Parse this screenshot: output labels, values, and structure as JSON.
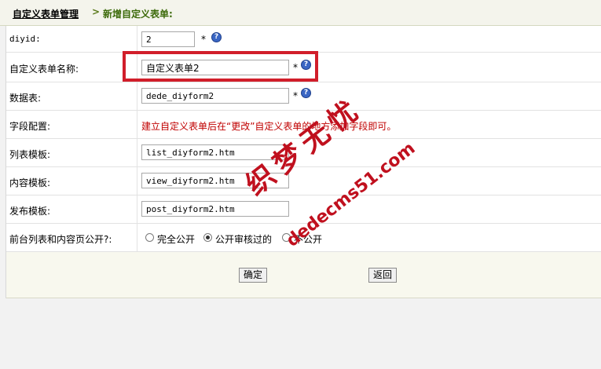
{
  "breadcrumb": {
    "parent": "自定义表单管理",
    "separator": ">",
    "current": "新增自定义表单:"
  },
  "form": {
    "diyid_label": "diyid:",
    "diyid_value": "2",
    "name_label": "自定义表单名称:",
    "name_value": "自定义表单2",
    "table_label": "数据表:",
    "table_value": "dede_diyform2",
    "field_label": "字段配置:",
    "field_hint": "建立自定义表单后在“更改”自定义表单的地方添加字段即可。",
    "list_tpl_label": "列表模板:",
    "list_tpl_value": "list_diyform2.htm",
    "view_tpl_label": "内容模板:",
    "view_tpl_value": "view_diyform2.htm",
    "post_tpl_label": "发布模板:",
    "post_tpl_value": "post_diyform2.htm",
    "public_label": "前台列表和内容页公开?:",
    "public_options": [
      "完全公开",
      "公开审核过的",
      "不公开"
    ],
    "public_selected": "公开审核过的",
    "required_mark": "*",
    "help_icon_glyph": "?"
  },
  "buttons": {
    "ok": "确定",
    "back": "返回"
  },
  "watermark": {
    "text": "织梦无忧",
    "url": "dedecms51.com"
  },
  "colors": {
    "highlight_box": "#d11e2a",
    "hint_text": "#c00000",
    "breadcrumb_current": "#3c6a0a"
  }
}
